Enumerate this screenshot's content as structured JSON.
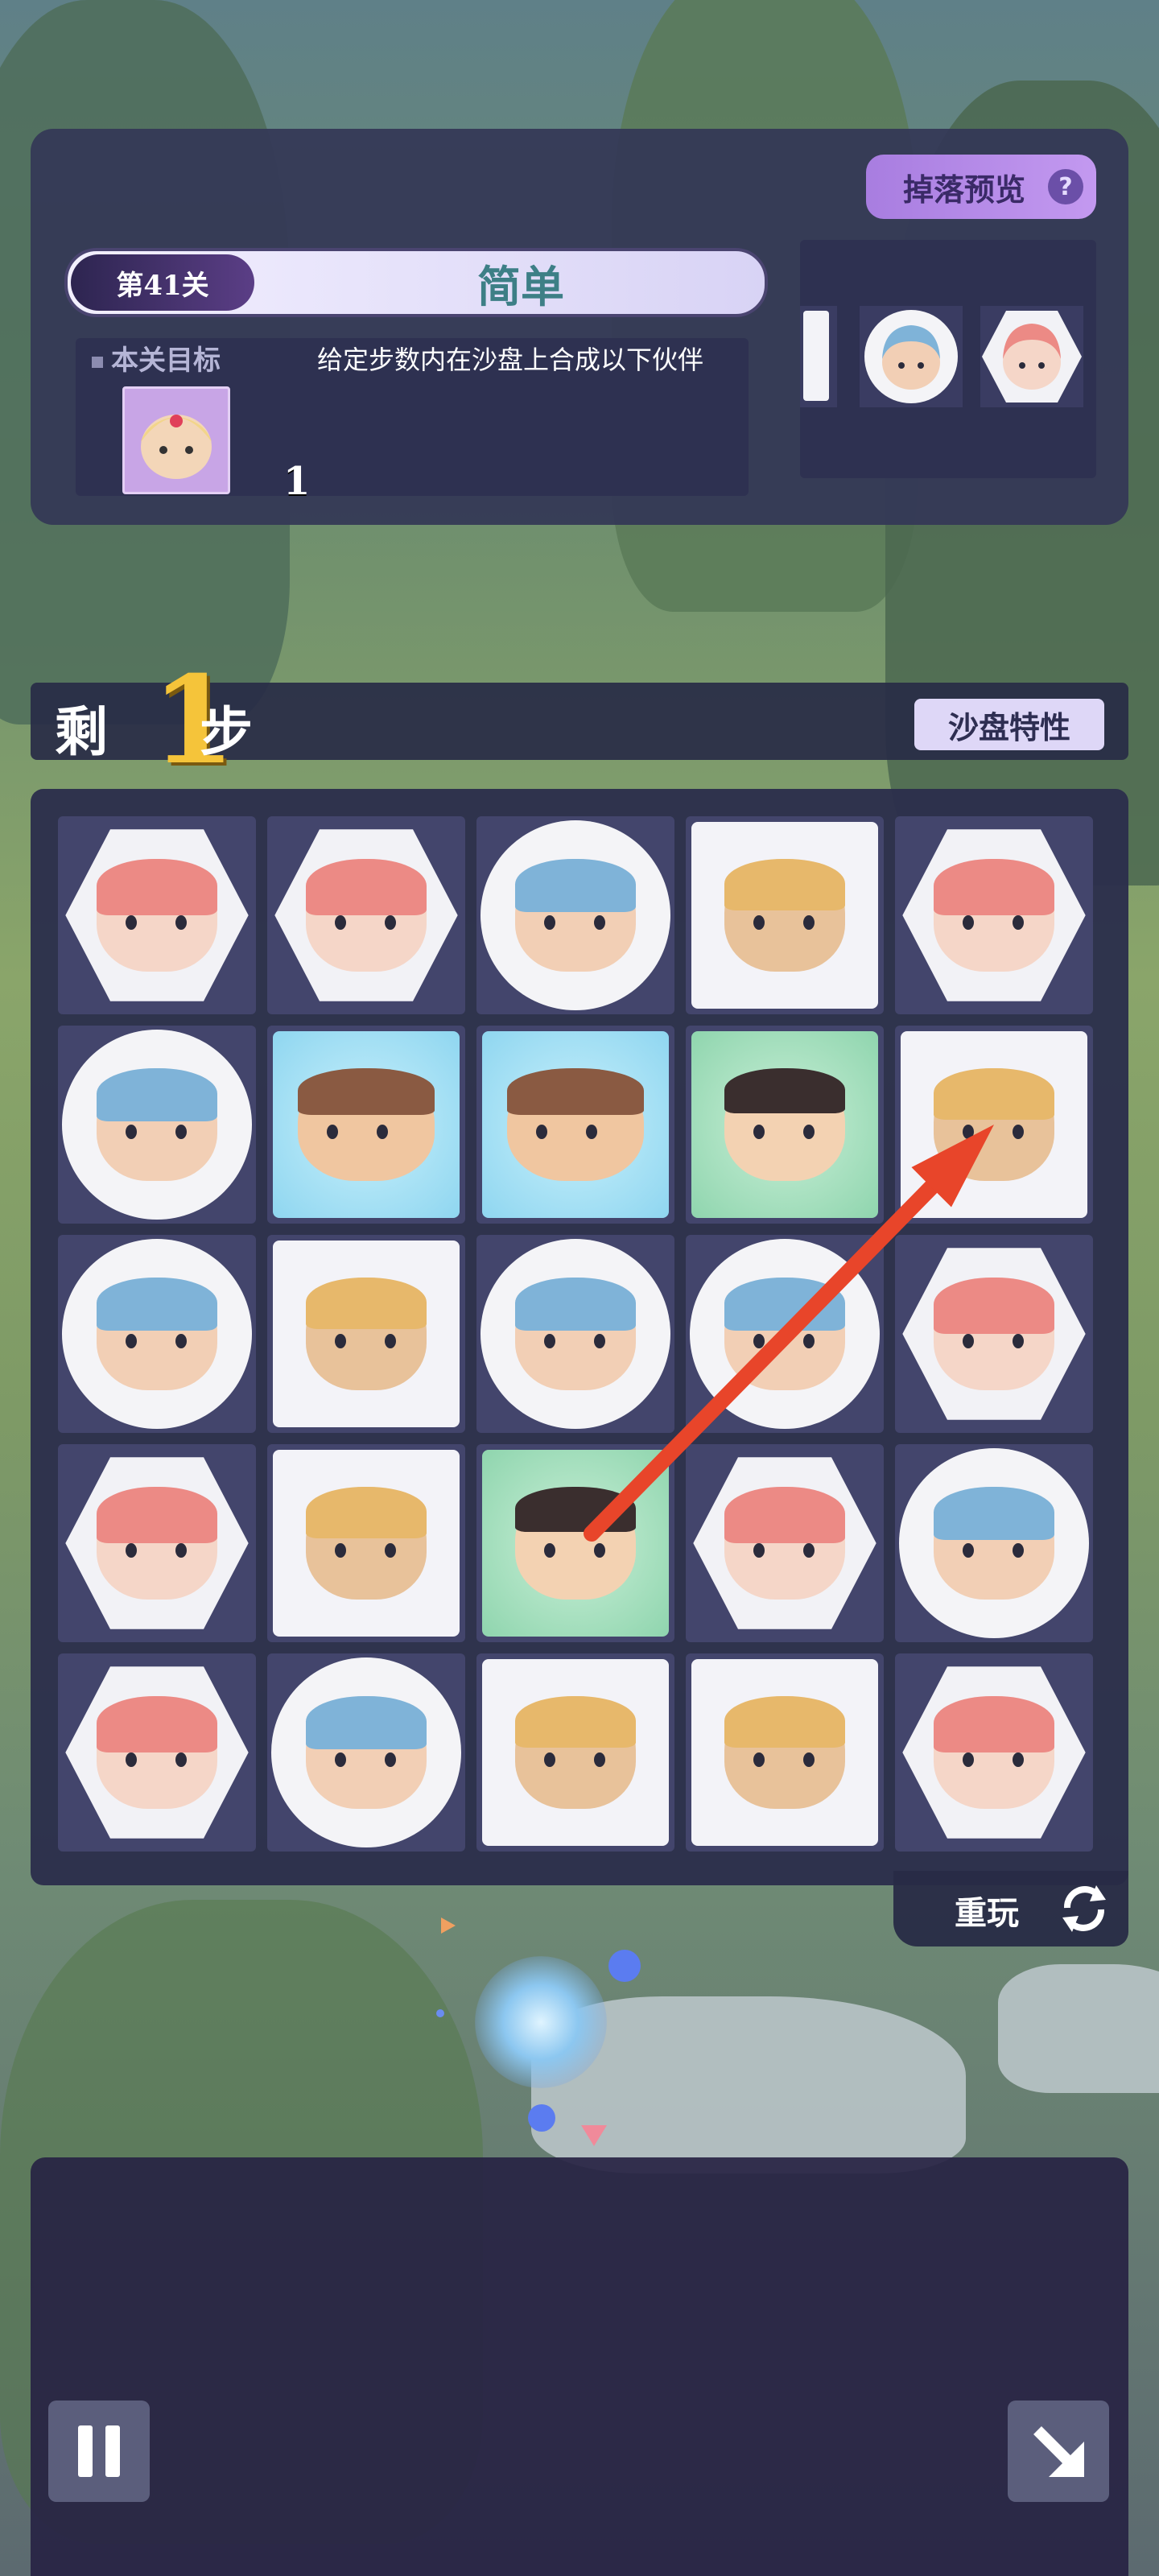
{
  "level": {
    "number_label": "第41关",
    "difficulty": "简单"
  },
  "goal": {
    "label": "本关目标",
    "description": "给定步数内在沙盘上合成以下伙伴",
    "target_count": "1"
  },
  "drop_preview": {
    "label": "掉落预览",
    "help_glyph": "?"
  },
  "steps": {
    "prefix": "剩",
    "count": "1",
    "suffix": "步"
  },
  "board_features_label": "沙盘特性",
  "replay_label": "重玩",
  "board": [
    [
      "pink-hex",
      "pink-hex",
      "blue-circle",
      "gold-square",
      "pink-hex"
    ],
    [
      "blue-circle",
      "bear-square-blue",
      "bear-square-blue",
      "crown-square-green",
      "gold-square"
    ],
    [
      "blue-circle",
      "gold-square",
      "blue-circle",
      "blue-circle",
      "pink-hex"
    ],
    [
      "pink-hex",
      "gold-square",
      "crown-square-green",
      "pink-hex",
      "blue-circle"
    ],
    [
      "pink-hex",
      "blue-circle",
      "gold-square",
      "gold-square",
      "pink-hex"
    ]
  ],
  "hint_arrow": {
    "from": [
      3,
      2
    ],
    "to": [
      1,
      4
    ],
    "color": "#e8452a"
  },
  "colors": {
    "accent": "#a87de0",
    "steps_number": "#f5c43a",
    "difficulty_text": "#3d7f86"
  },
  "icons": {
    "pause": "pause-icon",
    "exit": "exit-arrow-icon",
    "replay": "refresh-icon"
  }
}
